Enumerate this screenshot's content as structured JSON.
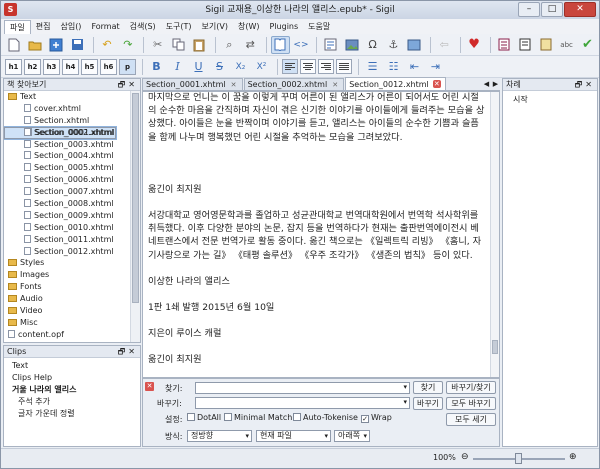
{
  "window": {
    "title": "Sigil 교재용_이상한 나라의 앨리스.epub* - Sigil",
    "min": "–",
    "max": "□",
    "close": "✕",
    "app_icon": "S"
  },
  "menu": [
    "파일",
    "편집",
    "삽입()",
    "Format",
    "검색(S)",
    "도구(T)",
    "보기(V)",
    "창(W)",
    "Plugins",
    "도움말"
  ],
  "headings": [
    "h1",
    "h2",
    "h3",
    "h4",
    "h5",
    "h6",
    "p"
  ],
  "book_browser": {
    "title": "책 찾아보기",
    "items": [
      {
        "label": "Text",
        "kind": "folder",
        "indent": 0
      },
      {
        "label": "cover.xhtml",
        "kind": "file",
        "indent": 1
      },
      {
        "label": "Section.xhtml",
        "kind": "file",
        "indent": 1
      },
      {
        "label": "Section_0001.xhtml",
        "kind": "file",
        "indent": 1,
        "selected": true
      },
      {
        "label": "Section_0002.xhtml",
        "kind": "file",
        "indent": 1
      },
      {
        "label": "Section_0003.xhtml",
        "kind": "file",
        "indent": 1
      },
      {
        "label": "Section_0004.xhtml",
        "kind": "file",
        "indent": 1
      },
      {
        "label": "Section_0005.xhtml",
        "kind": "file",
        "indent": 1
      },
      {
        "label": "Section_0006.xhtml",
        "kind": "file",
        "indent": 1
      },
      {
        "label": "Section_0007.xhtml",
        "kind": "file",
        "indent": 1
      },
      {
        "label": "Section_0008.xhtml",
        "kind": "file",
        "indent": 1
      },
      {
        "label": "Section_0009.xhtml",
        "kind": "file",
        "indent": 1
      },
      {
        "label": "Section_0010.xhtml",
        "kind": "file",
        "indent": 1
      },
      {
        "label": "Section_0011.xhtml",
        "kind": "file",
        "indent": 1
      },
      {
        "label": "Section_0012.xhtml",
        "kind": "file",
        "indent": 1
      },
      {
        "label": "Styles",
        "kind": "folder",
        "indent": 0
      },
      {
        "label": "Images",
        "kind": "folder",
        "indent": 0
      },
      {
        "label": "Fonts",
        "kind": "folder",
        "indent": 0
      },
      {
        "label": "Audio",
        "kind": "folder",
        "indent": 0
      },
      {
        "label": "Video",
        "kind": "folder",
        "indent": 0
      },
      {
        "label": "Misc",
        "kind": "folder",
        "indent": 0
      },
      {
        "label": "content.opf",
        "kind": "file",
        "indent": 0
      }
    ]
  },
  "clips": {
    "title": "Clips",
    "items": [
      {
        "label": "Text",
        "bold": false,
        "indent": 0
      },
      {
        "label": "Clips Help",
        "bold": false,
        "indent": 0
      },
      {
        "label": "거울 나라의 앨리스",
        "bold": true,
        "indent": 0
      },
      {
        "label": "주석 추가",
        "bold": false,
        "indent": 1
      },
      {
        "label": "글자 가운데 정렬",
        "bold": false,
        "indent": 1
      }
    ]
  },
  "tabs": [
    {
      "label": "Section_0001.xhtml",
      "active": false
    },
    {
      "label": "Section_0002.xhtml",
      "active": false
    },
    {
      "label": "Section_0012.xhtml",
      "active": true
    }
  ],
  "editor": {
    "paragraphs": [
      "마지막으로 언니는 이 꿈을 이렇게 꾸며 어른이 된 앨리스가 어른이 되어서도 어린 시절의 순수한 마음을 간직하며 자신이 겪은 신기한 이야기를 아이들에게 들려주는 모습을 상상했다. 아이들은 눈을 반짝이며 이야기를 듣고, 앨리스는 아이들의 순수한 기쁨과 슬픔을 함께 나누며 행복했던 어린 시절을 추억하는 모습을 그려보았다.",
      "",
      "옮긴이 최지원",
      "서강대학교 영어영문학과를 졸업하고 성균관대학교 번역대학원에서 번역학 석사학위를 취득했다. 이후 다양한 분야의 논문, 잡지 등을 번역하다가 현재는 출판번역에이전시 베네트랜스에서 전문 번역가로 활동 중이다. 옮긴 책으로는 《일렉트릭 리빙》 《홈니, 자기사랑으로 가는 길》 《태평 솔루션》 《우주 조각가》 《생존의 법칙》 등이 있다.",
      "이상한 나라의 앨리스",
      "1판 1쇄 발행 2015년 6월 10일",
      "지은이 루이스 캐럴",
      "옮긴이 최지원"
    ]
  },
  "contents": {
    "title": "차례",
    "items": [
      "시작"
    ]
  },
  "find": {
    "find_label": "찾기:",
    "replace_label": "바꾸기:",
    "find_btn": "찾기",
    "replace_find_btn": "바꾸기/찾기",
    "replace_btn": "바꾸기",
    "replace_all_btn": "모두 바꾸기",
    "count_all_btn": "모두 세기",
    "settings_label": "설정:",
    "opt_dotall": "DotAll",
    "opt_minimal": "Minimal Match",
    "opt_tokenise": "Auto-Tokenise",
    "opt_wrap": "Wrap",
    "mode_label": "방식:",
    "mode_value": "정방향",
    "scope_value": "현재 파일",
    "lookin_value": "아래쪽"
  },
  "status": {
    "zoom": "100%"
  }
}
